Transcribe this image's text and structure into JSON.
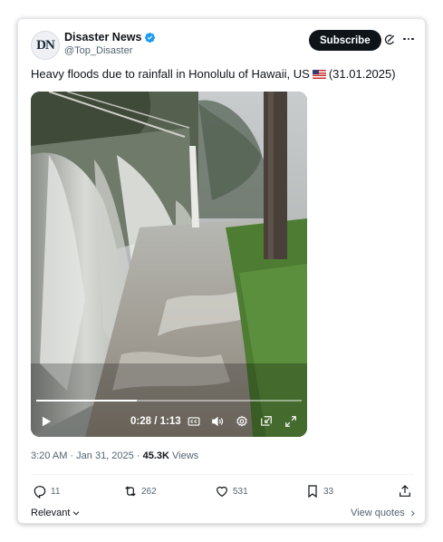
{
  "account": {
    "avatar_initials": "DN",
    "name": "Disaster News",
    "handle": "@Top_Disaster",
    "verified": true
  },
  "header_actions": {
    "subscribe_label": "Subscribe",
    "grok_icon": "grok-icon",
    "more_icon": "more-icon"
  },
  "tweet": {
    "text_before_flag": "Heavy floods due to rainfall in Honolulu of Hawaii, US",
    "flag": "us-flag",
    "text_after_flag": "(31.01.2025)"
  },
  "video": {
    "current_time": "0:28",
    "separator": "/",
    "duration": "1:13",
    "progress_fraction": 0.38,
    "controls": [
      "play-icon",
      "captions-icon",
      "volume-icon",
      "settings-icon",
      "pip-icon",
      "fullscreen-icon"
    ]
  },
  "meta": {
    "time": "3:20 AM",
    "dot": "·",
    "date": "Jan 31, 2025",
    "dot2": "·",
    "views_count": "45.3K",
    "views_label": "Views"
  },
  "actions": {
    "replies": "11",
    "reposts": "262",
    "likes": "531",
    "bookmarks": "33"
  },
  "footer": {
    "relevant_label": "Relevant",
    "view_quotes_label": "View quotes"
  },
  "colors": {
    "text": "#0f1419",
    "secondary": "#536471",
    "verified_blue": "#1d9bf0",
    "subscribe_bg": "#0f1419"
  }
}
